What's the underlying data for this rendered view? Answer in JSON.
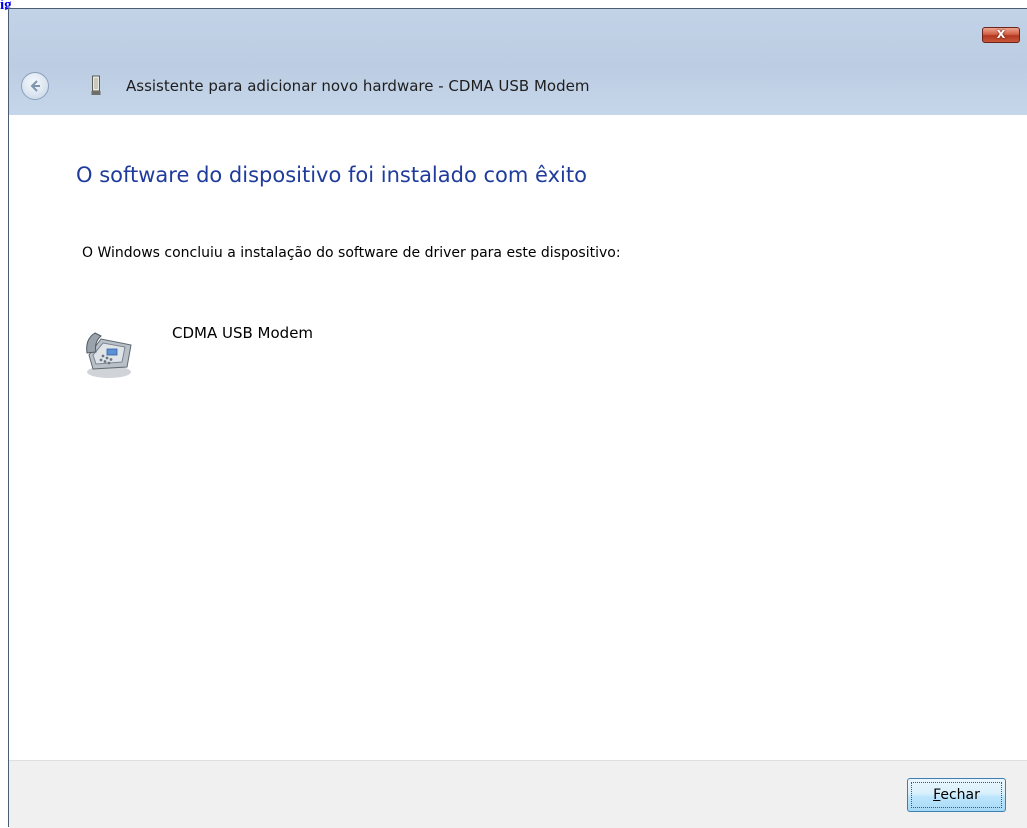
{
  "page_fragment": "ig",
  "window": {
    "title": "Assistente para adicionar novo hardware - CDMA USB Modem",
    "close_glyph": "X"
  },
  "content": {
    "heading": "O software do dispositivo foi instalado com êxito",
    "description": "O Windows concluiu a instalação do software de driver para este dispositivo:",
    "device_name": "CDMA USB Modem",
    "device_icon": "phone-modem-icon"
  },
  "footer": {
    "close_button": {
      "accelerator": "F",
      "rest": "echar"
    }
  },
  "colors": {
    "heading": "#1f3c9c",
    "frame": "#c6d5e8",
    "close_button": "#c8573b"
  }
}
